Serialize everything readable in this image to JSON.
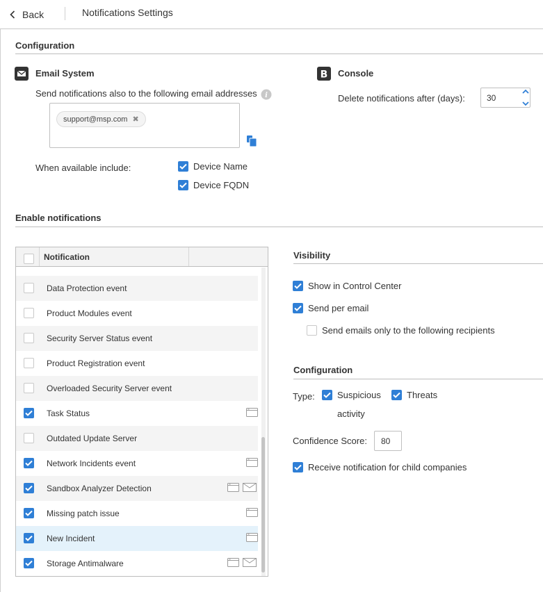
{
  "header": {
    "back_label": "Back",
    "title": "Notifications Settings"
  },
  "configuration_title": "Configuration",
  "email_system": {
    "title": "Email System",
    "description": "Send notifications also to the following email addresses",
    "emails": [
      "support@msp.com"
    ],
    "include_label": "When available include:",
    "include_options": [
      {
        "label": "Device Name",
        "checked": true
      },
      {
        "label": "Device FQDN",
        "checked": true
      }
    ]
  },
  "console": {
    "title": "Console",
    "delete_label": "Delete notifications after (days):",
    "delete_days": "30"
  },
  "enable_title": "Enable notifications",
  "table": {
    "header": "Notification",
    "rows": [
      {
        "label": "Data Protection event",
        "checked": false,
        "icons": []
      },
      {
        "label": "Product Modules event",
        "checked": false,
        "icons": []
      },
      {
        "label": "Security Server Status event",
        "checked": false,
        "icons": []
      },
      {
        "label": "Product Registration event",
        "checked": false,
        "icons": []
      },
      {
        "label": "Overloaded Security Server event",
        "checked": false,
        "icons": []
      },
      {
        "label": "Task Status",
        "checked": true,
        "icons": [
          "console-icon"
        ]
      },
      {
        "label": "Outdated Update Server",
        "checked": false,
        "icons": []
      },
      {
        "label": "Network Incidents event",
        "checked": true,
        "icons": [
          "console-icon"
        ]
      },
      {
        "label": "Sandbox Analyzer Detection",
        "checked": true,
        "icons": [
          "console-icon",
          "email-icon"
        ]
      },
      {
        "label": "Missing patch issue",
        "checked": true,
        "icons": [
          "console-icon"
        ]
      },
      {
        "label": "New Incident",
        "checked": true,
        "icons": [
          "console-icon"
        ],
        "selected": true
      },
      {
        "label": "Storage Antimalware",
        "checked": true,
        "icons": [
          "console-icon",
          "email-icon"
        ]
      }
    ]
  },
  "visibility": {
    "title": "Visibility",
    "show_in_control_center": {
      "label": "Show in Control Center",
      "checked": true
    },
    "send_per_email": {
      "label": "Send per email",
      "checked": true
    },
    "only_recipients": {
      "label": "Send emails only to the following recipients",
      "checked": false
    }
  },
  "detail_configuration": {
    "title": "Configuration",
    "type_label": "Type:",
    "type_options": [
      {
        "label_line1": "Suspicious",
        "label_line2": "activity",
        "checked": true
      },
      {
        "label": "Threats",
        "checked": true
      }
    ],
    "confidence_label": "Confidence Score:",
    "confidence_value": "80",
    "child_companies": {
      "label": "Receive notification for child companies",
      "checked": true
    }
  },
  "colors": {
    "accent": "#2f7fd6",
    "selected_row": "#e4f2fb"
  }
}
